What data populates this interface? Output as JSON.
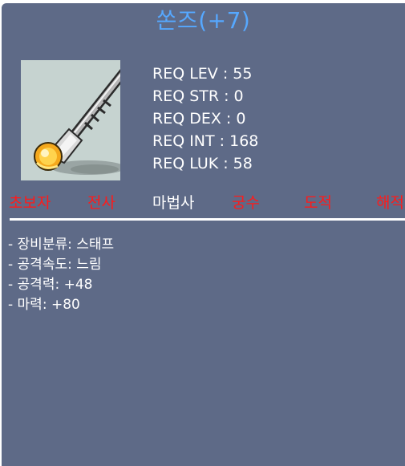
{
  "item": {
    "name": "쏜즈(+7)",
    "name_color": "#56a8ff",
    "icon": "staff-icon"
  },
  "requirements": [
    "REQ LEV : 55",
    "REQ STR : 0",
    "REQ DEX : 0",
    "REQ INT : 168",
    "REQ LUK : 58"
  ],
  "jobs": [
    {
      "label": "초보자",
      "usable": false
    },
    {
      "label": "전사",
      "usable": false
    },
    {
      "label": "마법사",
      "usable": true
    },
    {
      "label": "궁수",
      "usable": false
    },
    {
      "label": "도적",
      "usable": false
    },
    {
      "label": "해적",
      "usable": false
    }
  ],
  "stats": [
    "- 장비분류: 스태프",
    "- 공격속도: 느림",
    "- 공격력: +48",
    "- 마력: +80"
  ],
  "colors": {
    "panel": "#5e6a87",
    "usable": "#ffffff",
    "not_usable": "#ff1a1a"
  }
}
